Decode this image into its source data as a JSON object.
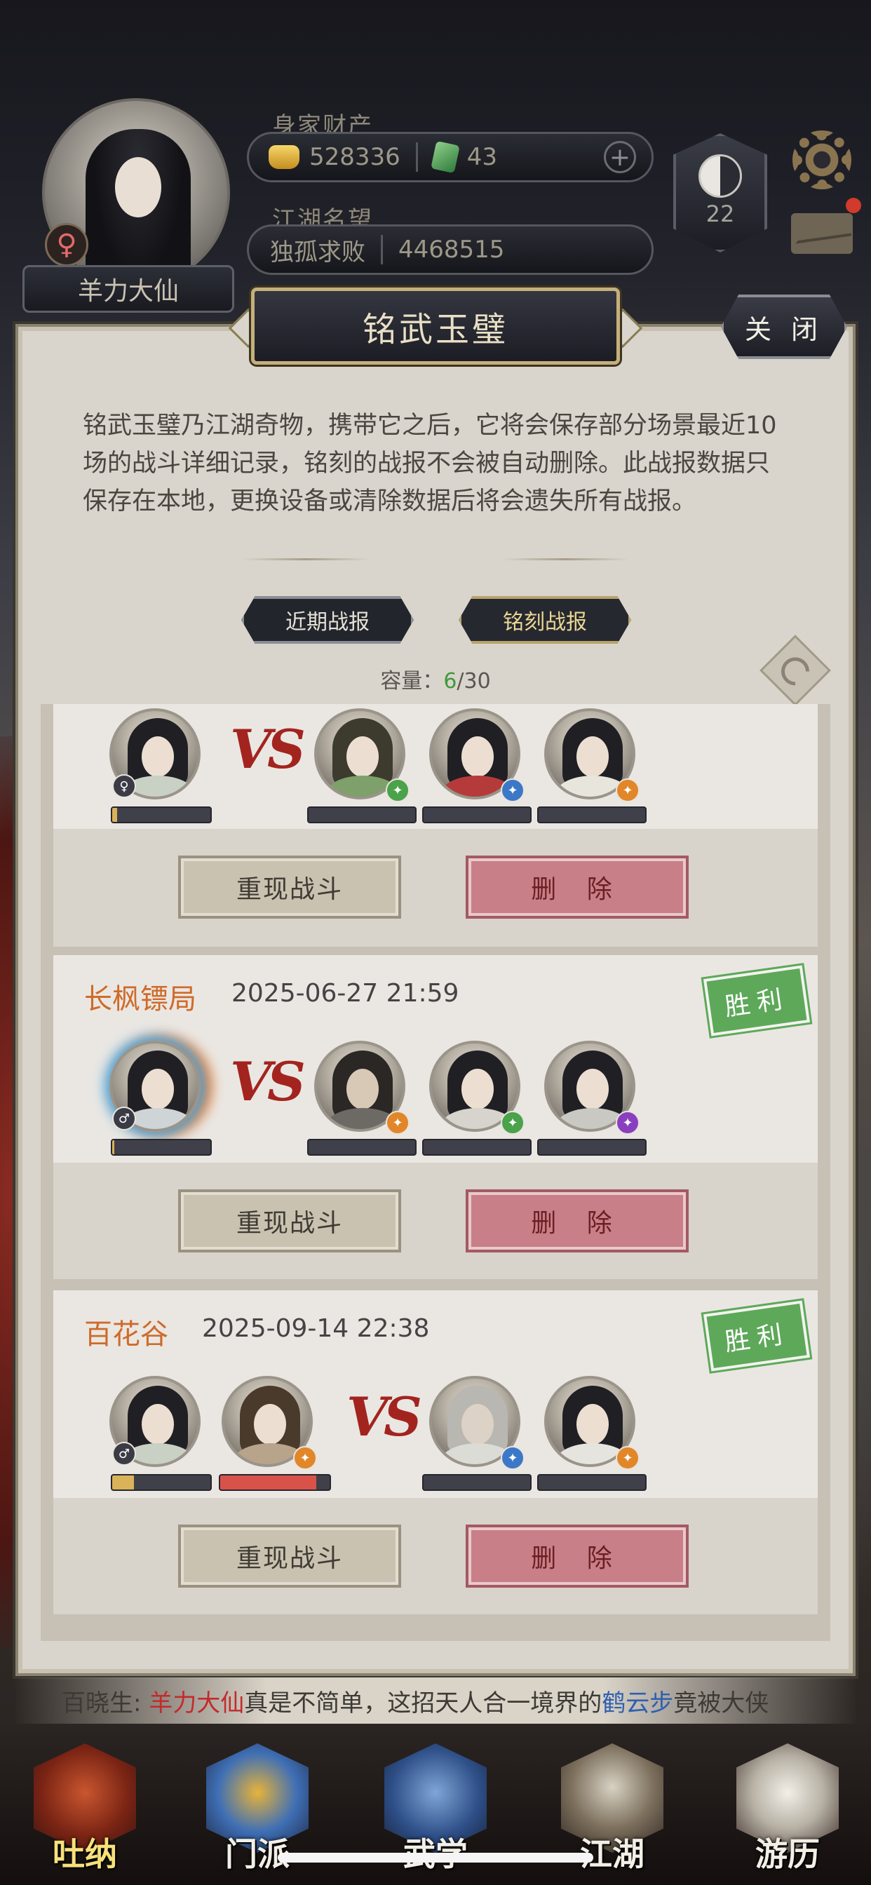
{
  "header": {
    "player_name": "羊力大仙",
    "gender_symbol": "♀",
    "wealth_label": "身家财产",
    "gold": "528336",
    "jade": "43",
    "plus": "+",
    "fame_label": "江湖名望",
    "fame_title": "独孤求败",
    "fame_value": "4468515",
    "rank_level": "22"
  },
  "panel": {
    "title": "铭武玉璧",
    "close_label": "关 闭",
    "description": "铭武玉璧乃江湖奇物，携带它之后，它将会保存部分场景最近10场的战斗详细记录，铭刻的战报不会被自动删除。此战报数据只保存在本地，更换设备或清除数据后将会遗失所有战报。",
    "tabs": [
      {
        "label": "近期战报",
        "active": false
      },
      {
        "label": "铭刻战报",
        "active": true
      }
    ],
    "capacity": {
      "label": "容量：",
      "used": "6",
      "total": "/30"
    }
  },
  "records": [
    {
      "name": "",
      "time": "",
      "result": "",
      "allies": [
        {
          "gender": "♀",
          "hp": 0.05
        }
      ],
      "enemies": [
        {
          "elem": "green"
        },
        {
          "elem": "blue"
        },
        {
          "elem": "orange"
        }
      ],
      "replay_label": "重现战斗",
      "delete_label": "删 除"
    },
    {
      "name": "长枫镖局",
      "time": "2025-06-27 21:59",
      "result": "胜利",
      "allies": [
        {
          "gender": "♂",
          "hp": 0.02
        }
      ],
      "enemies": [
        {
          "elem": "orange"
        },
        {
          "elem": "green"
        },
        {
          "elem": "purple"
        }
      ],
      "replay_label": "重现战斗",
      "delete_label": "删 除"
    },
    {
      "name": "百花谷",
      "time": "2025-09-14 22:38",
      "result": "胜利",
      "allies": [
        {
          "gender": "♂",
          "hp": 0.22
        },
        {
          "elem": "orange",
          "hp": 0.88
        }
      ],
      "enemies": [
        {
          "elem": "blue"
        },
        {
          "elem": "orange"
        }
      ],
      "replay_label": "重现战斗",
      "delete_label": "删 除"
    }
  ],
  "ticker": {
    "speaker": "百晓生:",
    "player": "羊力大仙",
    "text1": "真是不简单，这招天人合一境界的",
    "skill": "鹤云步",
    "text2": "竟被大侠"
  },
  "nav": [
    {
      "label": "吐纳",
      "icon": "meditation-icon"
    },
    {
      "label": "门派",
      "icon": "sect-icon"
    },
    {
      "label": "武学",
      "icon": "martial-book-icon"
    },
    {
      "label": "江湖",
      "icon": "straw-hat-icon"
    },
    {
      "label": "游历",
      "icon": "horse-icon"
    }
  ],
  "colors": {
    "accent_gold": "#c4b07a",
    "victory_green": "#5ea85a",
    "delete_red": "#c97f87",
    "name_orange": "#cf6b2a"
  }
}
